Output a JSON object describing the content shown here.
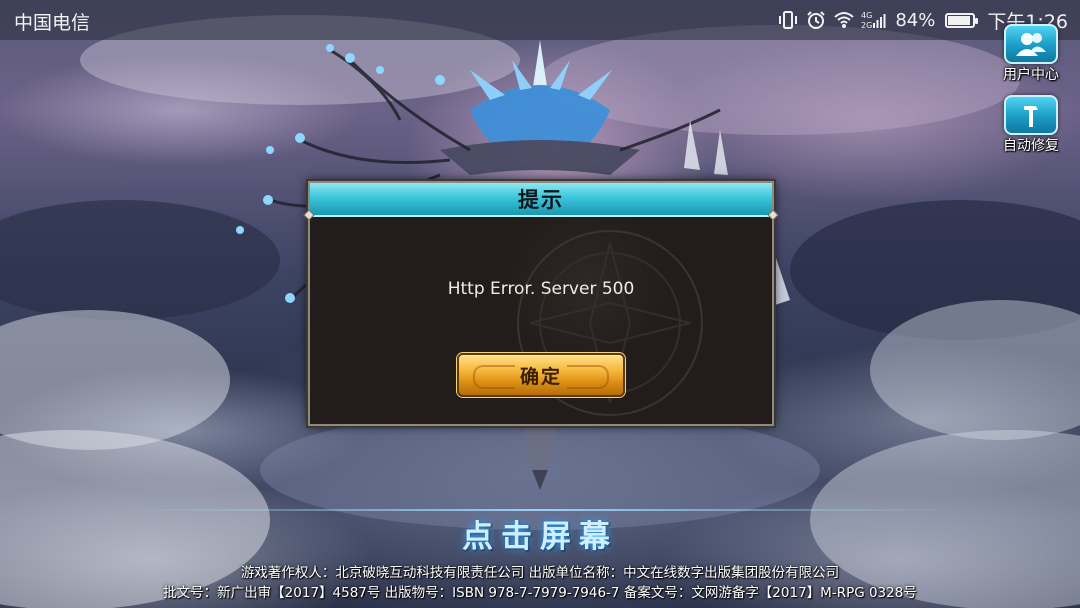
{
  "status_bar": {
    "carrier": "中国电信",
    "battery_percent": "84%",
    "battery_level": 0.84,
    "time": "下午1:26",
    "icons": [
      "vibrate-icon",
      "alarm-icon",
      "wifi-icon",
      "signal-4g-icon",
      "battery-icon"
    ]
  },
  "side_buttons": {
    "user_center": {
      "label": "用户中心",
      "icon": "users-icon"
    },
    "auto_repair": {
      "label": "自动修复",
      "icon": "hammer-icon"
    }
  },
  "dialog": {
    "title": "提示",
    "message": "Http Error. Server 500",
    "confirm_label": "确定"
  },
  "footer": {
    "tap_screen": "点击屏幕",
    "legal_line_1": "游戏著作权人：北京破晓互动科技有限责任公司 出版单位名称：中文在线数字出版集团股份有限公司",
    "legal_line_2": "批文号：新广出审【2017】4587号 出版物号：ISBN 978-7-7979-7946-7 备案文号：文网游备字【2017】M-RPG 0328号"
  },
  "colors": {
    "dialog_header": "#3cc6db",
    "confirm_button": "#f6b73a",
    "tap_glow": "#3fa9ff"
  }
}
